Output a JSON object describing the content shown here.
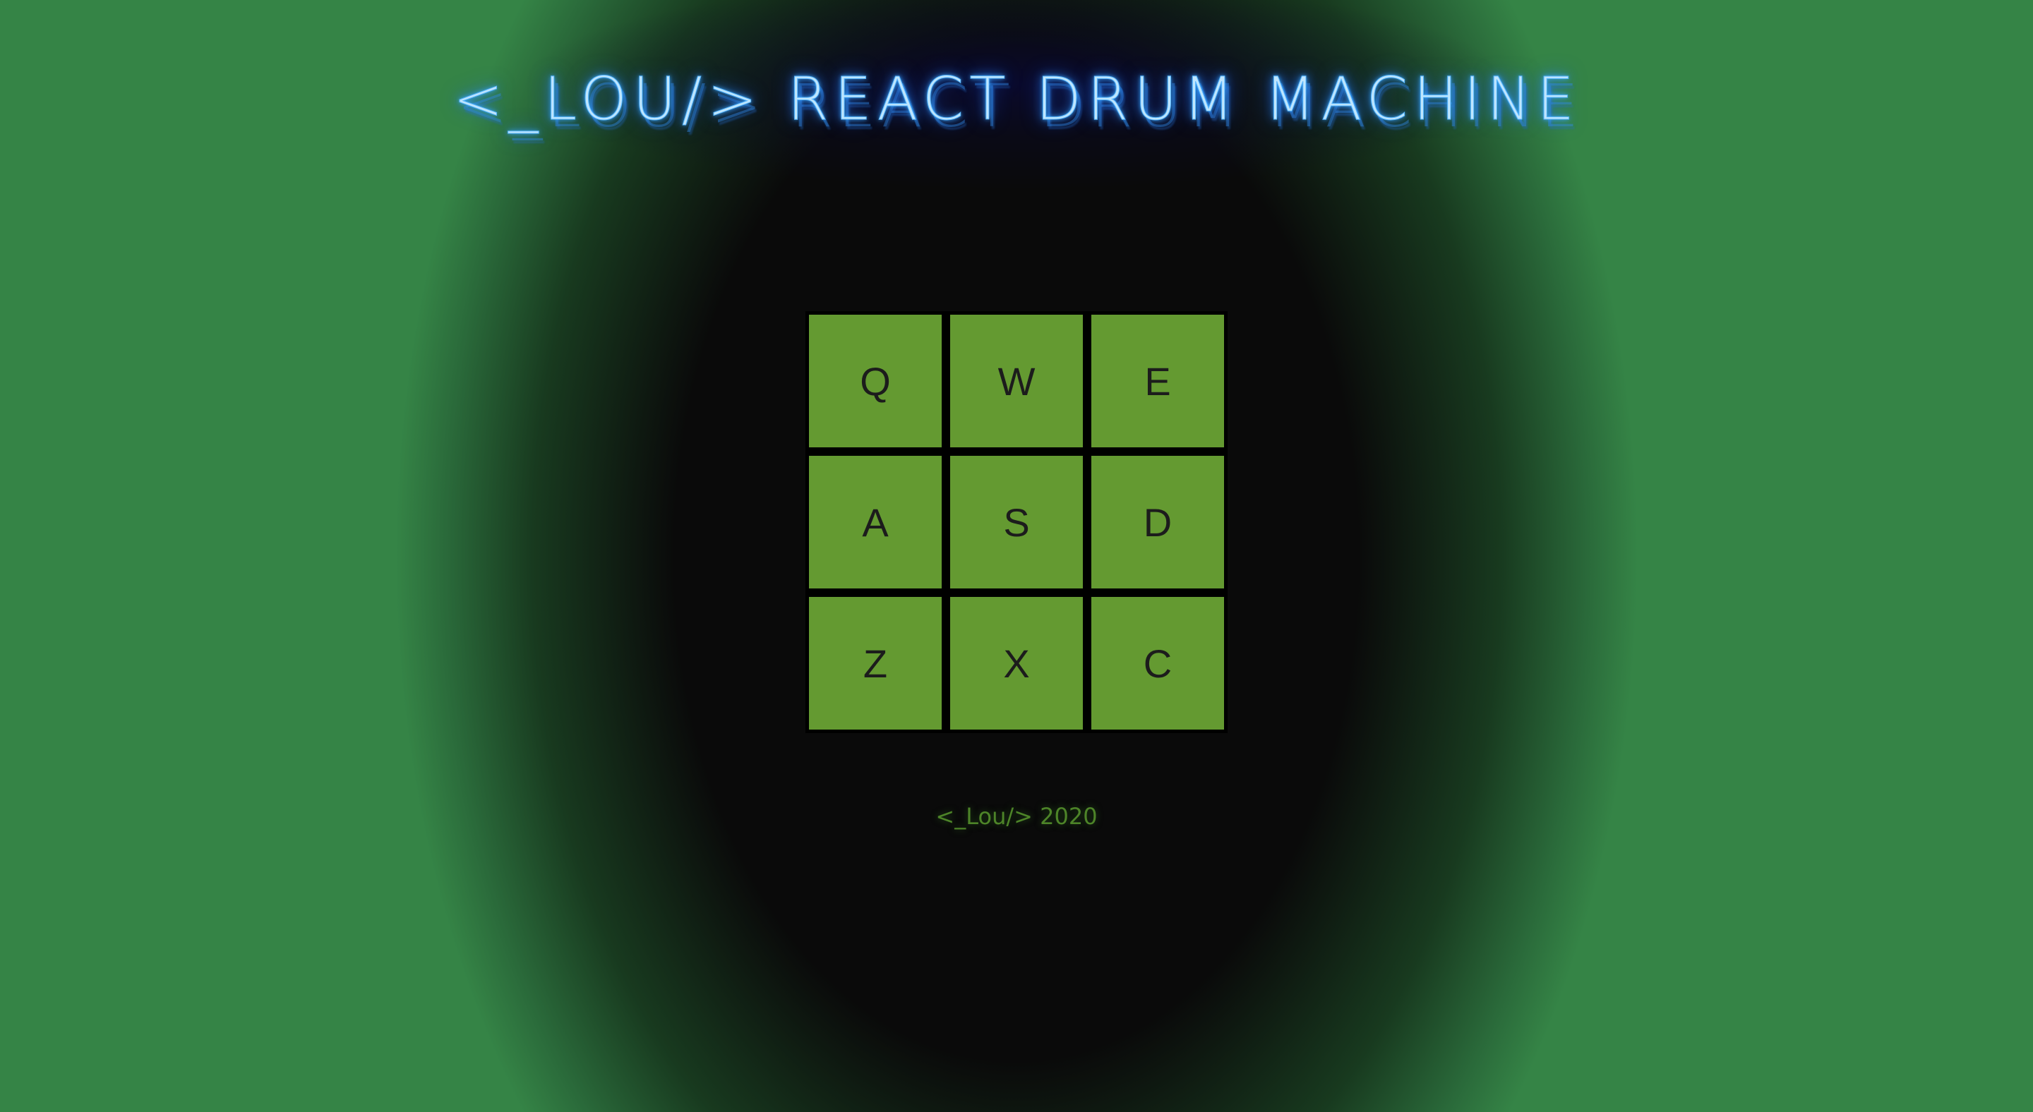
{
  "header": {
    "title": "<_Lou/> React Drum Machine"
  },
  "drum_pads": [
    {
      "key": "Q"
    },
    {
      "key": "W"
    },
    {
      "key": "E"
    },
    {
      "key": "A"
    },
    {
      "key": "S"
    },
    {
      "key": "D"
    },
    {
      "key": "Z"
    },
    {
      "key": "X"
    },
    {
      "key": "C"
    }
  ],
  "footer": {
    "text": "<_Lou/> 2020"
  },
  "colors": {
    "pad": "#649a31",
    "title_neon": "#57b6ff",
    "background_edge": "#358446",
    "footer_text": "#4d8428"
  }
}
